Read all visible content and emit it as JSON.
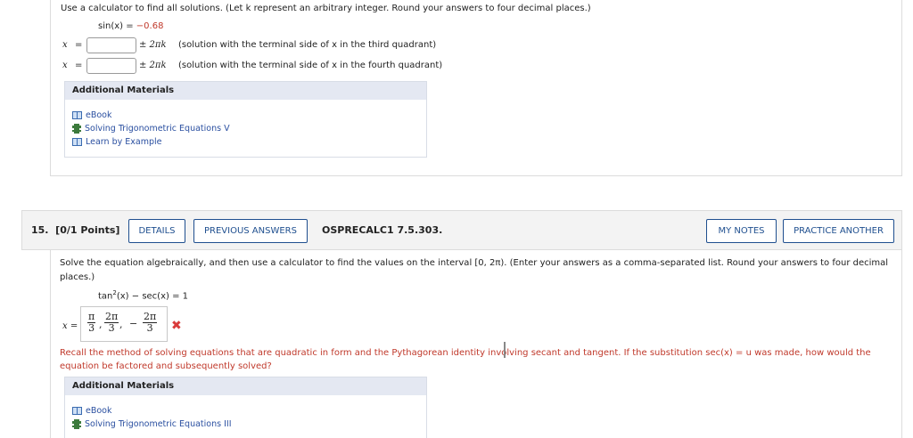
{
  "prev_question": {
    "instruction": "Use a calculator to find all solutions. (Let k represent an arbitrary integer. Round your answers to four decimal places.)",
    "equation_left": "sin(x) = ",
    "equation_value": "−0.68",
    "rows": [
      {
        "var": "x",
        "eq": "=",
        "value": "",
        "period": "± 2πk",
        "note": "(solution with the terminal side of x in the third quadrant)"
      },
      {
        "var": "x",
        "eq": "=",
        "value": "",
        "period": "± 2πk",
        "note": "(solution with the terminal side of x in the fourth quadrant)"
      }
    ],
    "additional_materials": {
      "title": "Additional Materials",
      "links": [
        {
          "label": "eBook",
          "icon": "book-icon"
        },
        {
          "label": "Solving Trigonometric Equations V",
          "icon": "video-icon"
        },
        {
          "label": "Learn by Example",
          "icon": "book-icon"
        }
      ]
    }
  },
  "question": {
    "number": "15.",
    "points": "[0/1 Points]",
    "details_label": "DETAILS",
    "previous_answers_label": "PREVIOUS ANSWERS",
    "code": "OSPRECALC1 7.5.303.",
    "my_notes_label": "MY NOTES",
    "practice_another_label": "PRACTICE ANOTHER",
    "text": "Solve the equation algebraically, and then use a calculator to find the values on the interval [0, 2π). (Enter your answers as a comma-separated list. Round your answers to four decimal places.)",
    "equation_lhs": "tan",
    "equation_exp": "2",
    "equation_rest": "(x) − sec(x) = 1",
    "answer_var": "x =",
    "answer": {
      "f1_num": "π",
      "f1_den": "3",
      "sep1": ",",
      "f2_num": "2π",
      "f2_den": "3",
      "sep2": ",",
      "dash": "−",
      "f3_num": "2π",
      "f3_den": "3"
    },
    "status": "✖",
    "hint": "Recall the method of solving equations that are quadratic in form and the Pythagorean identity involving secant and tangent. If the substitution sec(x) = u was made, how would the equation be factored and subsequently solved?",
    "additional_materials": {
      "title": "Additional Materials",
      "links": [
        {
          "label": "eBook",
          "icon": "book-icon"
        },
        {
          "label": "Solving Trigonometric Equations III",
          "icon": "video-icon"
        }
      ]
    }
  }
}
